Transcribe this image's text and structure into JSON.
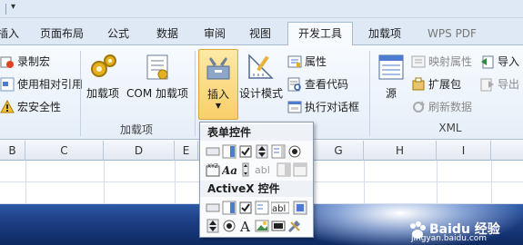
{
  "qat": {
    "menu_glyph": "▾"
  },
  "tabs": [
    {
      "label": "插入"
    },
    {
      "label": "页面布局"
    },
    {
      "label": "公式"
    },
    {
      "label": "数据"
    },
    {
      "label": "审阅"
    },
    {
      "label": "视图"
    },
    {
      "label": "开发工具",
      "active": true
    },
    {
      "label": "加载项"
    },
    {
      "label": "WPS PDF"
    }
  ],
  "code_group": {
    "record_macro": "录制宏",
    "relative_ref": "使用相对引用",
    "macro_security": "宏安全性"
  },
  "addins_group": {
    "addins": "加载项",
    "com_addins": "COM 加载项",
    "label": "加载项"
  },
  "controls_group": {
    "insert": "插入",
    "design_mode": "设计模式",
    "properties": "属性",
    "view_code": "查看代码",
    "run_dialog": "执行对话框"
  },
  "xml_group": {
    "source": "源",
    "map_props": "映射属性",
    "expansion": "扩展包",
    "refresh": "刷新数据",
    "import": "导入",
    "export": "导出",
    "label": "XML"
  },
  "columns": [
    "B",
    "C",
    "D",
    "E",
    "F",
    "G",
    "H",
    "I"
  ],
  "dropdown": {
    "form_controls_title": "表单控件",
    "activex_title": "ActiveX 控件"
  },
  "watermark": {
    "title": "Baidu 经验",
    "url": "jingyan.baidu.com"
  },
  "colors": {
    "accent_tab_bg": "#f7fbff",
    "insert_highlight": "#f9cf6a",
    "ribbon_bg": "#e6eef8",
    "desktop_blue": "#1d3f86"
  }
}
